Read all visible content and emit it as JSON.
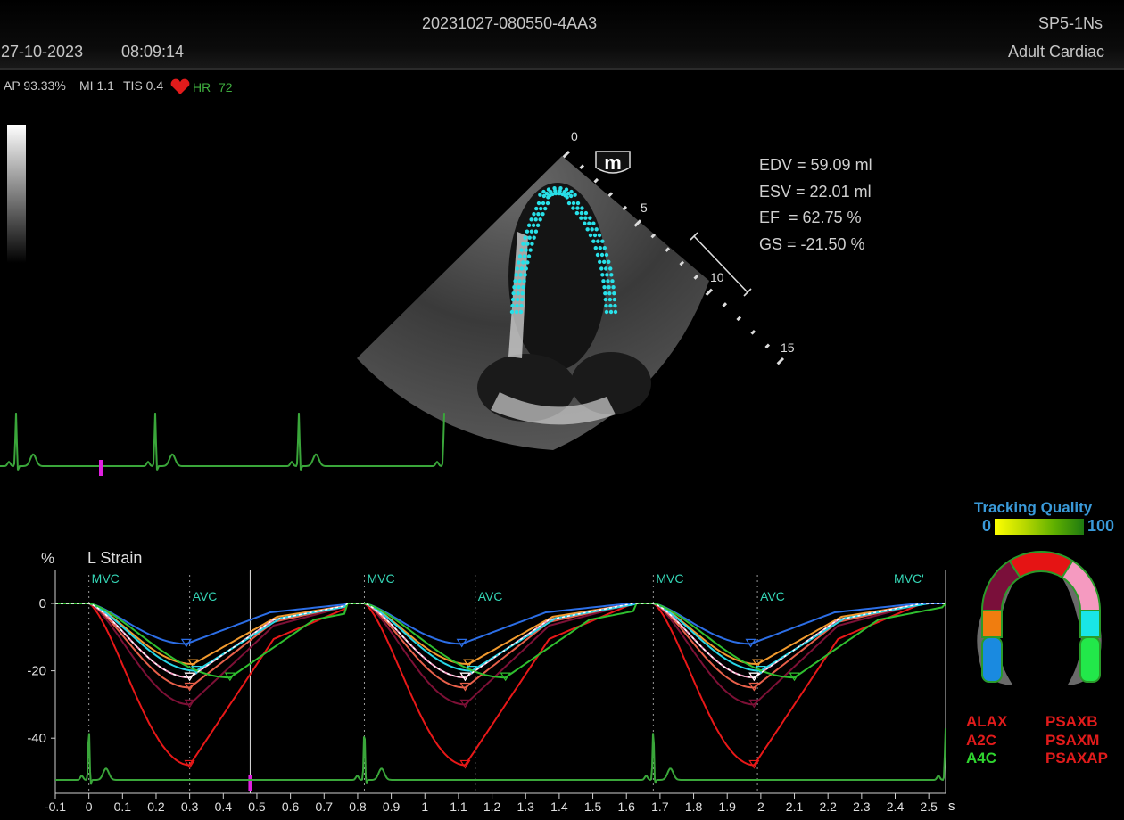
{
  "header": {
    "study_id": "20231027-080550-4AA3",
    "probe": "SP5-1Ns",
    "date": "27-10-2023",
    "time": "08:09:14",
    "preset": "Adult Cardiac"
  },
  "params": {
    "ap": "AP 93.33%",
    "mi": "MI 1.1",
    "tis": "TIS 0.4",
    "hr_label": "HR",
    "hr_value": "72"
  },
  "image": {
    "depth_marks": [
      "0",
      "5",
      "10",
      "15"
    ],
    "logo_icon": "m-logo-icon"
  },
  "measurements": {
    "edv": "EDV = 59.09 ml",
    "esv": "ESV = 22.01 ml",
    "ef": "EF  = 62.75 %",
    "gs": "GS = -21.50 %"
  },
  "tracking_quality": {
    "title": "Tracking Quality",
    "min": "0",
    "max": "100"
  },
  "segments_legend": {
    "left": [
      {
        "label": "ALAX",
        "color": "#e11b1b"
      },
      {
        "label": "A2C",
        "color": "#e11b1b"
      },
      {
        "label": "A4C",
        "color": "#2fd42f"
      }
    ],
    "right": [
      {
        "label": "PSAXB",
        "color": "#e11b1b"
      },
      {
        "label": "PSAXM",
        "color": "#e11b1b"
      },
      {
        "label": "PSAXAP",
        "color": "#e11b1b"
      }
    ]
  },
  "bullseye_colors": {
    "base": "#e51414",
    "left_upper": "#7a0f3a",
    "left_mid": "#f07d0f",
    "left_lower": "#1a8ae0",
    "right_upper": "#f59ac0",
    "right_mid": "#19e6e6",
    "right_lower": "#22e84a",
    "outline": "#2a9a2a"
  },
  "chart_data": {
    "type": "line",
    "title": "L Strain",
    "ylabel": "%",
    "xlabel": "s",
    "xlim": [
      -0.1,
      2.55
    ],
    "ylim": [
      -55,
      10
    ],
    "y_ticks": [
      0,
      -20,
      -40
    ],
    "x_ticks": [
      -0.1,
      0,
      0.1,
      0.2,
      0.3,
      0.4,
      0.5,
      0.6,
      0.7,
      0.8,
      0.9,
      1,
      1.1,
      1.2,
      1.3,
      1.4,
      1.5,
      1.6,
      1.7,
      1.8,
      1.9,
      2,
      2.1,
      2.2,
      2.3,
      2.4,
      2.5
    ],
    "events": [
      {
        "label": "MVC",
        "x": 0
      },
      {
        "label": "AVC",
        "x": 0.3
      },
      {
        "label": "MVC",
        "x": 0.82
      },
      {
        "label": "AVC",
        "x": 1.15
      },
      {
        "label": "MVC",
        "x": 1.68
      },
      {
        "label": "AVC",
        "x": 1.99
      },
      {
        "label": "MVC'",
        "x": 2.55
      }
    ],
    "cursor_x": 0.48,
    "cycles": [
      0.0,
      0.82,
      1.68
    ],
    "series": [
      {
        "color": "#e81818",
        "peak": -48,
        "tpeak": 0.3
      },
      {
        "color": "#7d1036",
        "peak": -30,
        "tpeak": 0.3
      },
      {
        "color": "#e8604a",
        "peak": -25,
        "tpeak": 0.3
      },
      {
        "color": "#f29a2e",
        "peak": -18,
        "tpeak": 0.31
      },
      {
        "color": "#f59ac0",
        "peak": -22,
        "tpeak": 0.3
      },
      {
        "color": "#28d6e6",
        "peak": -20,
        "tpeak": 0.32
      },
      {
        "color": "#2c6ee6",
        "peak": -12,
        "tpeak": 0.29
      },
      {
        "color": "#2fbf2f",
        "peak": -22,
        "tpeak": 0.42
      }
    ],
    "average": {
      "color": "#ffffff",
      "peak": -22,
      "tpeak": 0.3
    }
  }
}
